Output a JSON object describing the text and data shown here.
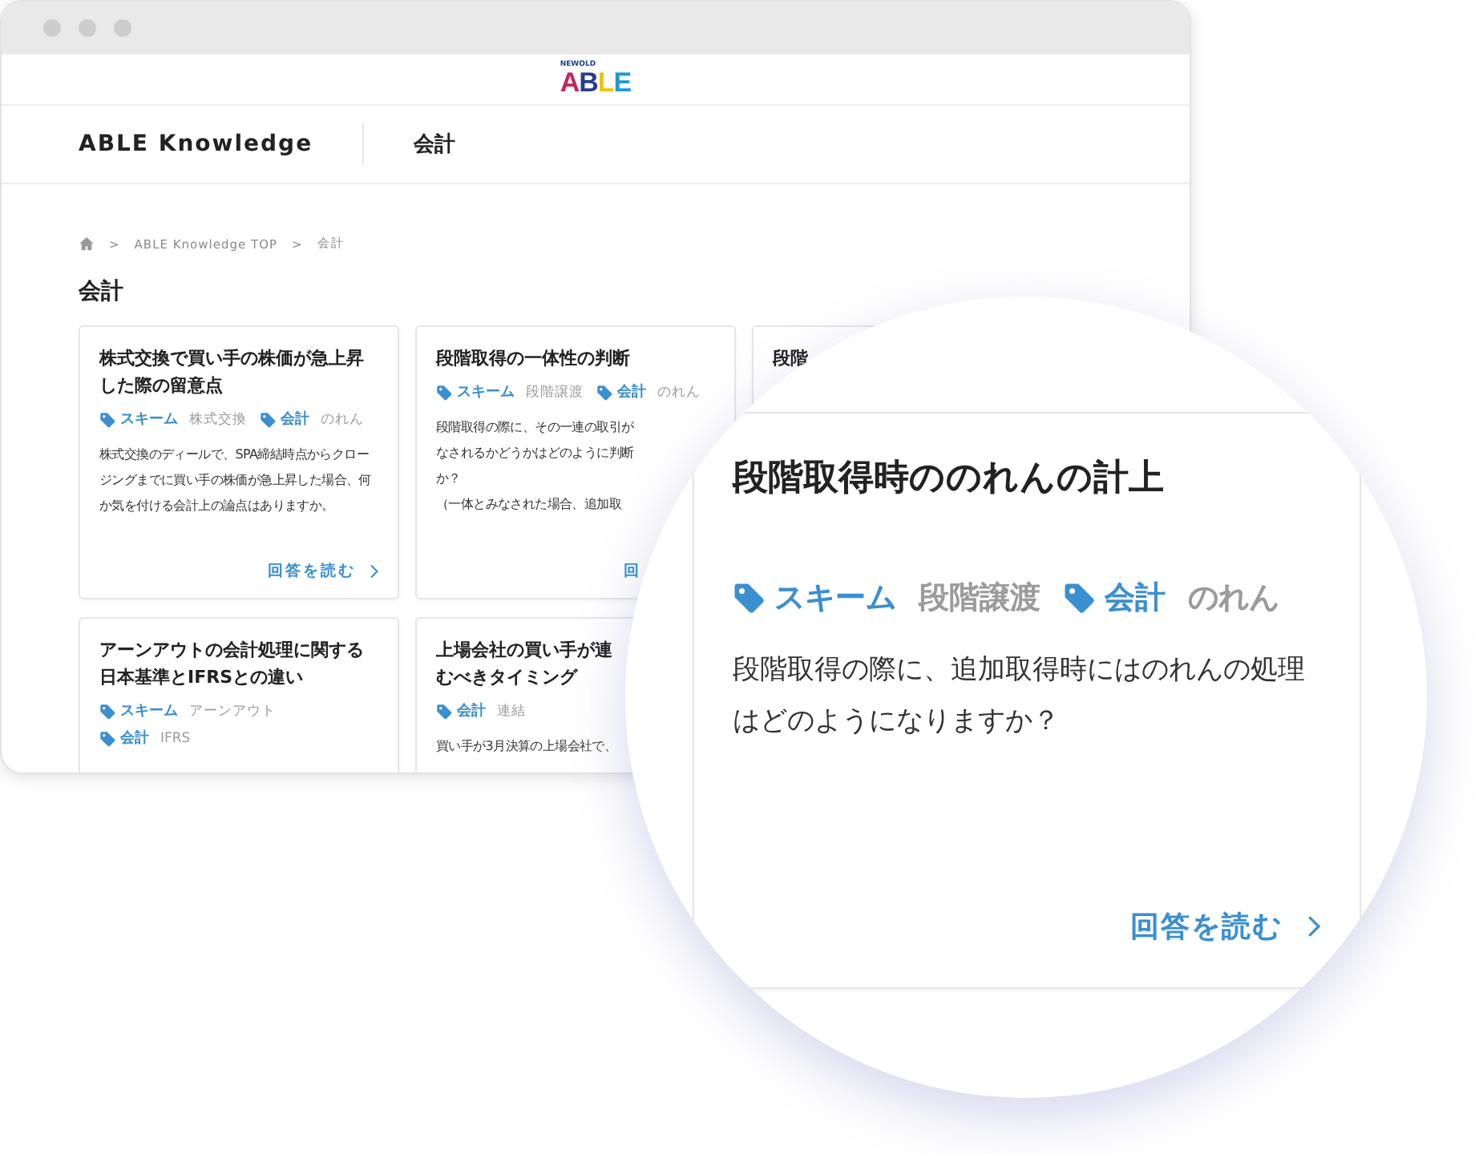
{
  "window": {
    "logo": {
      "small": "NEWOLD",
      "main": "ABLE"
    }
  },
  "nav": {
    "site": "ABLE Knowledge",
    "section": "会計"
  },
  "breadcrumb": [
    {
      "kind": "home"
    },
    {
      "kind": "sep",
      "text": ">"
    },
    {
      "kind": "link",
      "text": "ABLE Knowledge TOP"
    },
    {
      "kind": "sep",
      "text": ">"
    },
    {
      "kind": "current",
      "text": "会計"
    }
  ],
  "heading": "会計",
  "cards": [
    {
      "title": "株式交換で買い手の株価が急上昇した際の留意点",
      "tag_rows": [
        [
          {
            "category": "スキーム",
            "value": "株式交換"
          },
          {
            "category": "会計",
            "value": "のれん"
          }
        ]
      ],
      "description": "株式交換のディールで、SPA締結時点からクロージングまでに買い手の株価が急上昇した場合、何か気を付ける会計上の論点はありますか。",
      "link": {
        "text": "回答を読む",
        "chevron": true
      }
    },
    {
      "title": "段階取得の一体性の判断",
      "tag_rows": [
        [
          {
            "category": "スキーム",
            "value": "段階譲渡"
          },
          {
            "category": "会計",
            "value": "のれん"
          }
        ]
      ],
      "description_lines": [
        "段階取得の際に、その一連の取引が",
        "なされるかどうかはどのように判断",
        "か？",
        "（一体とみなされた場合、追加取"
      ],
      "link": {
        "text": "回",
        "chevron": false
      }
    },
    {
      "title": "段階"
    },
    {
      "title": "アーンアウトの会計処理に関する日本基準とIFRSとの違い",
      "tag_rows": [
        [
          {
            "category": "スキーム",
            "value": "アーンアウト"
          }
        ],
        [
          {
            "category": "会計",
            "value": "IFRS"
          }
        ]
      ]
    },
    {
      "title_lines": [
        "上場会社の買い手が連",
        "むべきタイミング"
      ],
      "tag_rows": [
        [
          {
            "category": "会計",
            "value": "連結"
          }
        ]
      ],
      "description": "買い手が3月決算の上場会社で、"
    }
  ],
  "zoom_card": {
    "title": "段階取得時ののれんの計上",
    "tag_rows": [
      [
        {
          "category": "スキーム",
          "value": "段階譲渡"
        },
        {
          "category": "会計",
          "value": "のれん"
        }
      ]
    ],
    "description": "段階取得の際に、追加取得時にはのれんの処理はどのようになりますか？",
    "link": {
      "text": "回答を読む",
      "chevron": true
    }
  }
}
